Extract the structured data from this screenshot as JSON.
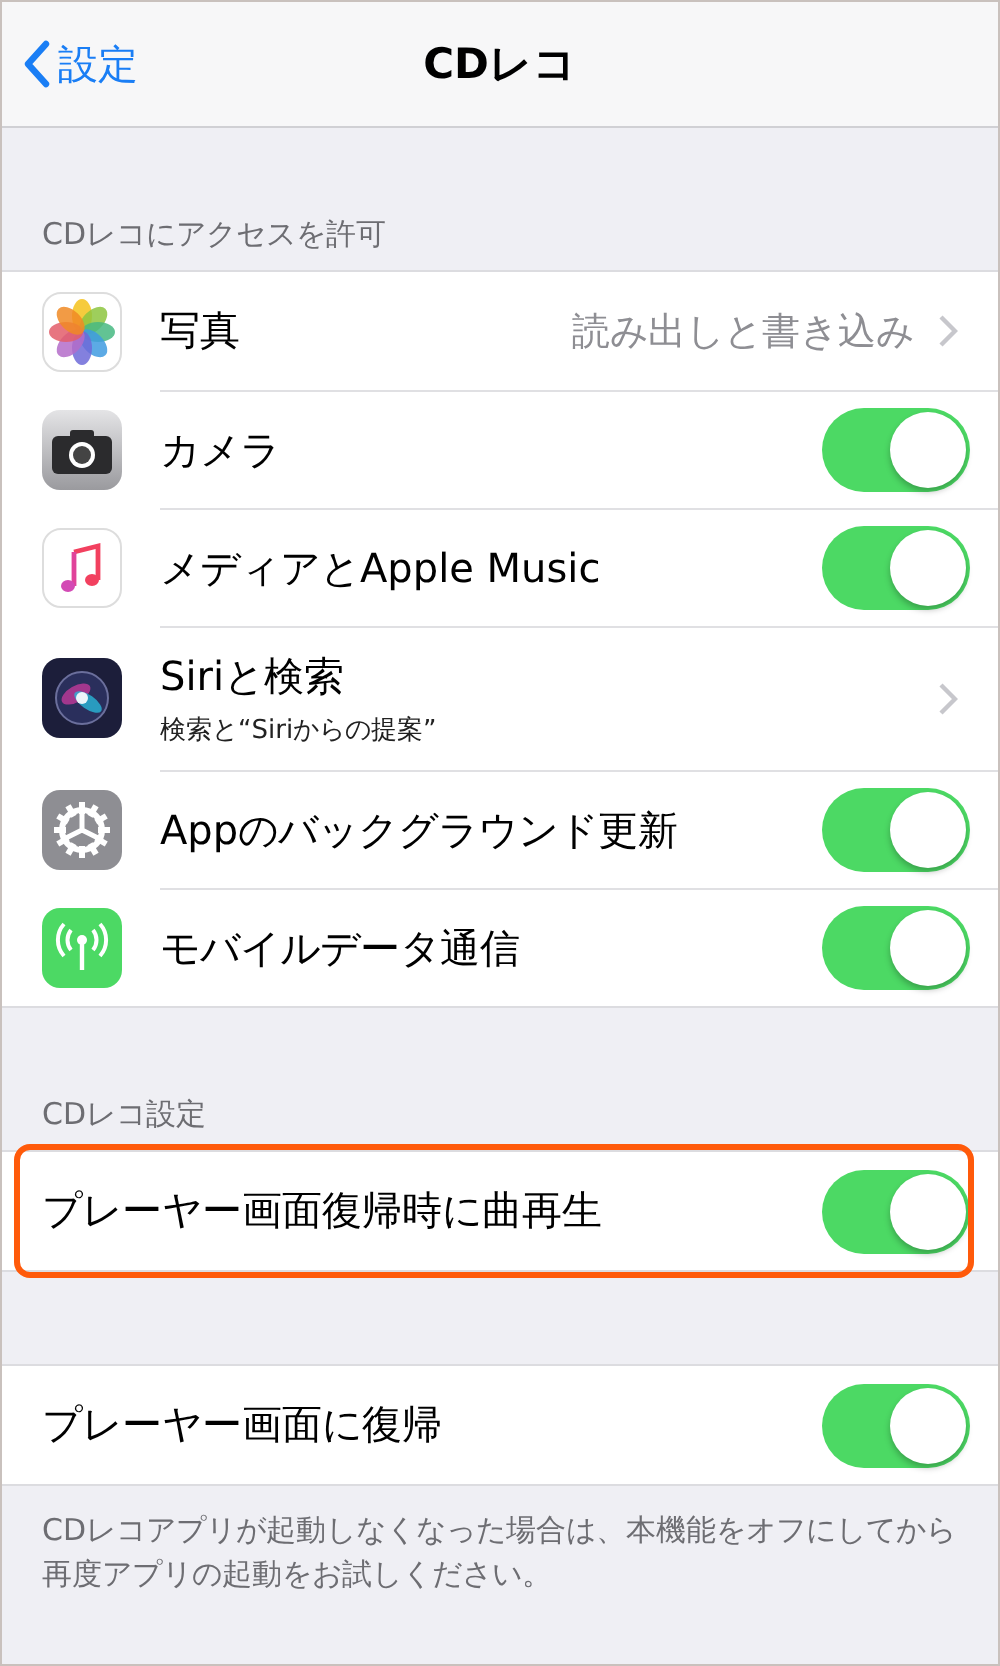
{
  "nav": {
    "back": "設定",
    "title": "CDレコ"
  },
  "sections": [
    {
      "header": "CDレコにアクセスを許可",
      "rows": [
        {
          "kind": "value",
          "label": "写真",
          "value": "読み出しと書き込み"
        },
        {
          "kind": "toggle",
          "label": "カメラ",
          "on": true
        },
        {
          "kind": "toggle",
          "label": "メディアとApple Music",
          "on": true
        },
        {
          "kind": "link",
          "label": "Siriと検索",
          "subtitle": "検索と“Siriからの提案”"
        },
        {
          "kind": "toggle",
          "label": "Appのバックグラウンド更新",
          "on": true
        },
        {
          "kind": "toggle",
          "label": "モバイルデータ通信",
          "on": true
        }
      ]
    },
    {
      "header": "CDレコ設定",
      "rows": [
        {
          "kind": "toggle",
          "label": "プレーヤー画面復帰時に曲再生",
          "on": true,
          "highlighted": true
        }
      ]
    },
    {
      "rows": [
        {
          "kind": "toggle",
          "label": "プレーヤー画面に復帰",
          "on": true
        }
      ],
      "footer": "CDレコアプリが起動しなくなった場合は、本機能をオフにしてから再度アプリの起動をお試しください。"
    }
  ]
}
